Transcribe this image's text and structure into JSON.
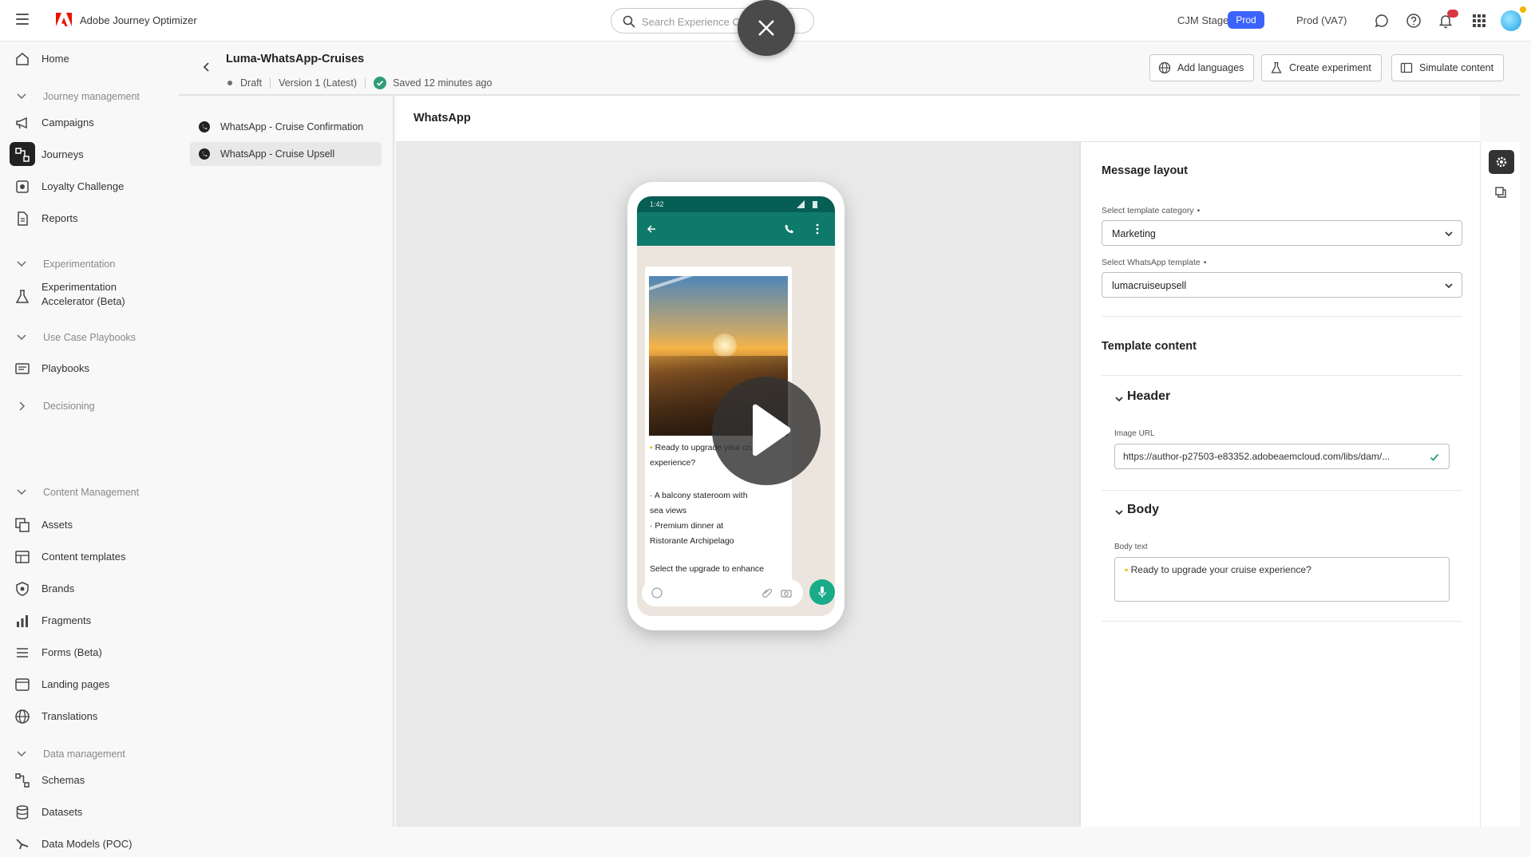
{
  "app": {
    "name": "Adobe Journey Optimizer"
  },
  "search": {
    "placeholder": "Search Experience Cloud"
  },
  "topbar": {
    "org": "CJM Stage",
    "env_badge": "Prod",
    "sandbox": "Prod (VA7)"
  },
  "nav": {
    "home": "Home",
    "journey_management": "Journey management",
    "campaigns": "Campaigns",
    "journeys": "Journeys",
    "loyalty": "Loyalty Challenge",
    "reports": "Reports",
    "experimentation": "Experimentation",
    "exp_accel_1": "Experimentation",
    "exp_accel_2": "Accelerator (Beta)",
    "use_case_playbooks": "Use Case Playbooks",
    "playbooks": "Playbooks",
    "decisioning": "Decisioning",
    "content_management": "Content Management",
    "assets": "Assets",
    "content_templates": "Content templates",
    "brands": "Brands",
    "fragments": "Fragments",
    "forms": "Forms (Beta)",
    "landing_pages": "Landing pages",
    "translations": "Translations",
    "data_management": "Data management",
    "schemas": "Schemas",
    "datasets": "Datasets",
    "data_models": "Data Models (POC)"
  },
  "header": {
    "title": "Luma-WhatsApp-Cruises",
    "status": "Draft",
    "version": "Version 1 (Latest)",
    "saved": "Saved 12 minutes ago",
    "add_languages": "Add languages",
    "create_experiment": "Create experiment",
    "simulate_content": "Simulate content"
  },
  "sublist": {
    "items": [
      "WhatsApp - Cruise Confirmation",
      "WhatsApp - Cruise Upsell"
    ]
  },
  "canvas": {
    "title": "WhatsApp",
    "phone_time": "1:42",
    "msg_line1": "Ready to upgrade your cruise",
    "msg_line2": "experience?",
    "msg_line3": "· A balcony stateroom with",
    "msg_line4": "sea views",
    "msg_line5": "· Premium dinner at",
    "msg_line6": "Ristorante Archipelago",
    "msg_line7": "Select the upgrade to enhance"
  },
  "panel": {
    "message_layout": "Message layout",
    "category_label": "Select template category",
    "category_value": "Marketing",
    "template_label": "Select WhatsApp template",
    "template_value": "lumacruiseupsell",
    "template_content": "Template content",
    "header_title": "Header",
    "image_url_label": "Image URL",
    "image_url_value": "https://author-p27503-e83352.adobeaemcloud.com/libs/dam/...",
    "body_title": "Body",
    "body_text_label": "Body text",
    "body_text_value": "Ready to upgrade your cruise experience?"
  }
}
